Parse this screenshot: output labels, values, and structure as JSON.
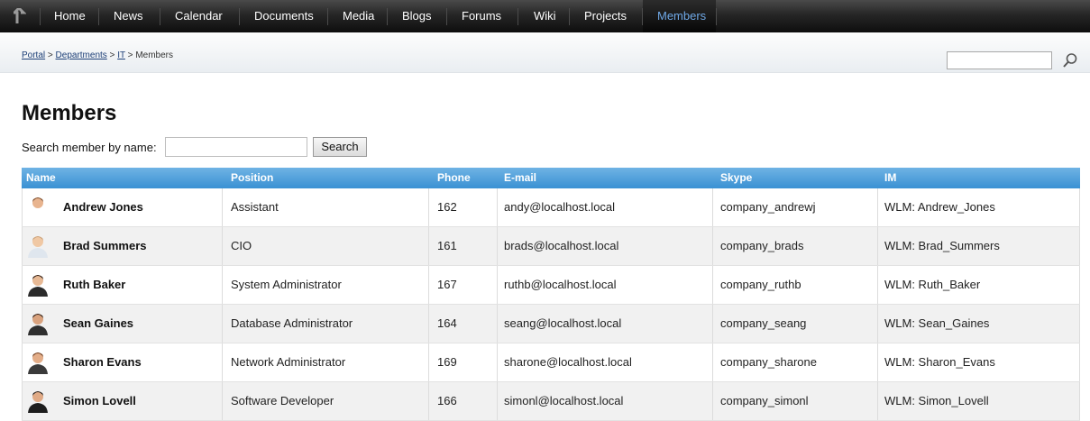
{
  "nav": {
    "items": [
      "Home",
      "News",
      "Calendar",
      "Documents",
      "Media",
      "Blogs",
      "Forums",
      "Wiki",
      "Projects",
      "Members"
    ],
    "active": "Members"
  },
  "breadcrumb": {
    "portal": "Portal",
    "sep1": " > ",
    "departments": "Departments",
    "sep2": " > ",
    "it": "IT",
    "sep3": " > ",
    "current": "Members"
  },
  "site_search": {
    "value": ""
  },
  "page_title": "Members",
  "member_search": {
    "label": "Search member by name:",
    "value": "",
    "button": "Search"
  },
  "table": {
    "headers": [
      "Name",
      "Position",
      "Phone",
      "E-mail",
      "Skype",
      "IM"
    ],
    "rows": [
      {
        "name": "Andrew Jones",
        "position": "Assistant",
        "phone": "162",
        "email": "andy@localhost.local",
        "skype": "company_andrewj",
        "im": "WLM: Andrew_Jones"
      },
      {
        "name": "Brad Summers",
        "position": "CIO",
        "phone": "161",
        "email": "brads@localhost.local",
        "skype": "company_brads",
        "im": "WLM: Brad_Summers"
      },
      {
        "name": "Ruth Baker",
        "position": "System Administrator",
        "phone": "167",
        "email": "ruthb@localhost.local",
        "skype": "company_ruthb",
        "im": "WLM: Ruth_Baker"
      },
      {
        "name": "Sean Gaines",
        "position": "Database Administrator",
        "phone": "164",
        "email": "seang@localhost.local",
        "skype": "company_seang",
        "im": "WLM: Sean_Gaines"
      },
      {
        "name": "Sharon Evans",
        "position": "Network Administrator",
        "phone": "169",
        "email": "sharone@localhost.local",
        "skype": "company_sharone",
        "im": "WLM: Sharon_Evans"
      },
      {
        "name": "Simon Lovell",
        "position": "Software Developer",
        "phone": "166",
        "email": "simonl@localhost.local",
        "skype": "company_simonl",
        "im": "WLM: Simon_Lovell"
      }
    ]
  },
  "colors": {
    "header_blue": "#3a91d3",
    "active_nav": "#6fa8e6",
    "link": "#1d3f77"
  },
  "icons": {
    "home": "home-arrow-icon",
    "search": "search-icon",
    "avatar": "avatar-photo"
  }
}
